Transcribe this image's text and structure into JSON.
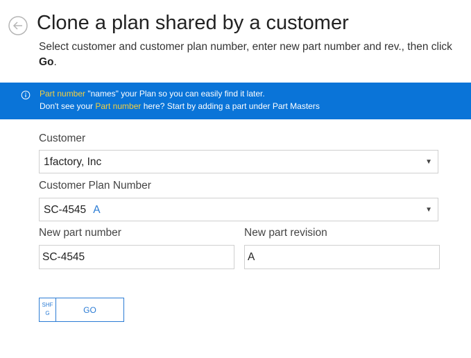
{
  "page": {
    "title": "Clone a plan shared by a customer",
    "instructions_pre": "Select customer and customer plan number, enter new part number and rev., then click ",
    "instructions_bold": "Go",
    "instructions_post": "."
  },
  "banner": {
    "line1_highlight": "Part number",
    "line1_rest": " \"names\" your Plan so you can easily find it later.",
    "line2_pre": "Don't see your ",
    "line2_highlight": "Part number",
    "line2_post": " here? Start by adding a part under Part Masters",
    "icon": "info-icon"
  },
  "form": {
    "customer_label": "Customer",
    "customer_value": "1factory, Inc",
    "plan_label": "Customer Plan Number",
    "plan_number": "SC-4545",
    "plan_revision": "A",
    "new_part_label": "New part number",
    "new_part_value": "SC-4545",
    "new_rev_label": "New part revision",
    "new_rev_value": "A"
  },
  "actions": {
    "shortcut_line1": "SHF",
    "shortcut_line2": "G",
    "go_label": "GO"
  },
  "colors": {
    "banner_bg": "#0a74d8",
    "highlight": "#f4d03f",
    "accent": "#2a7bd4"
  }
}
